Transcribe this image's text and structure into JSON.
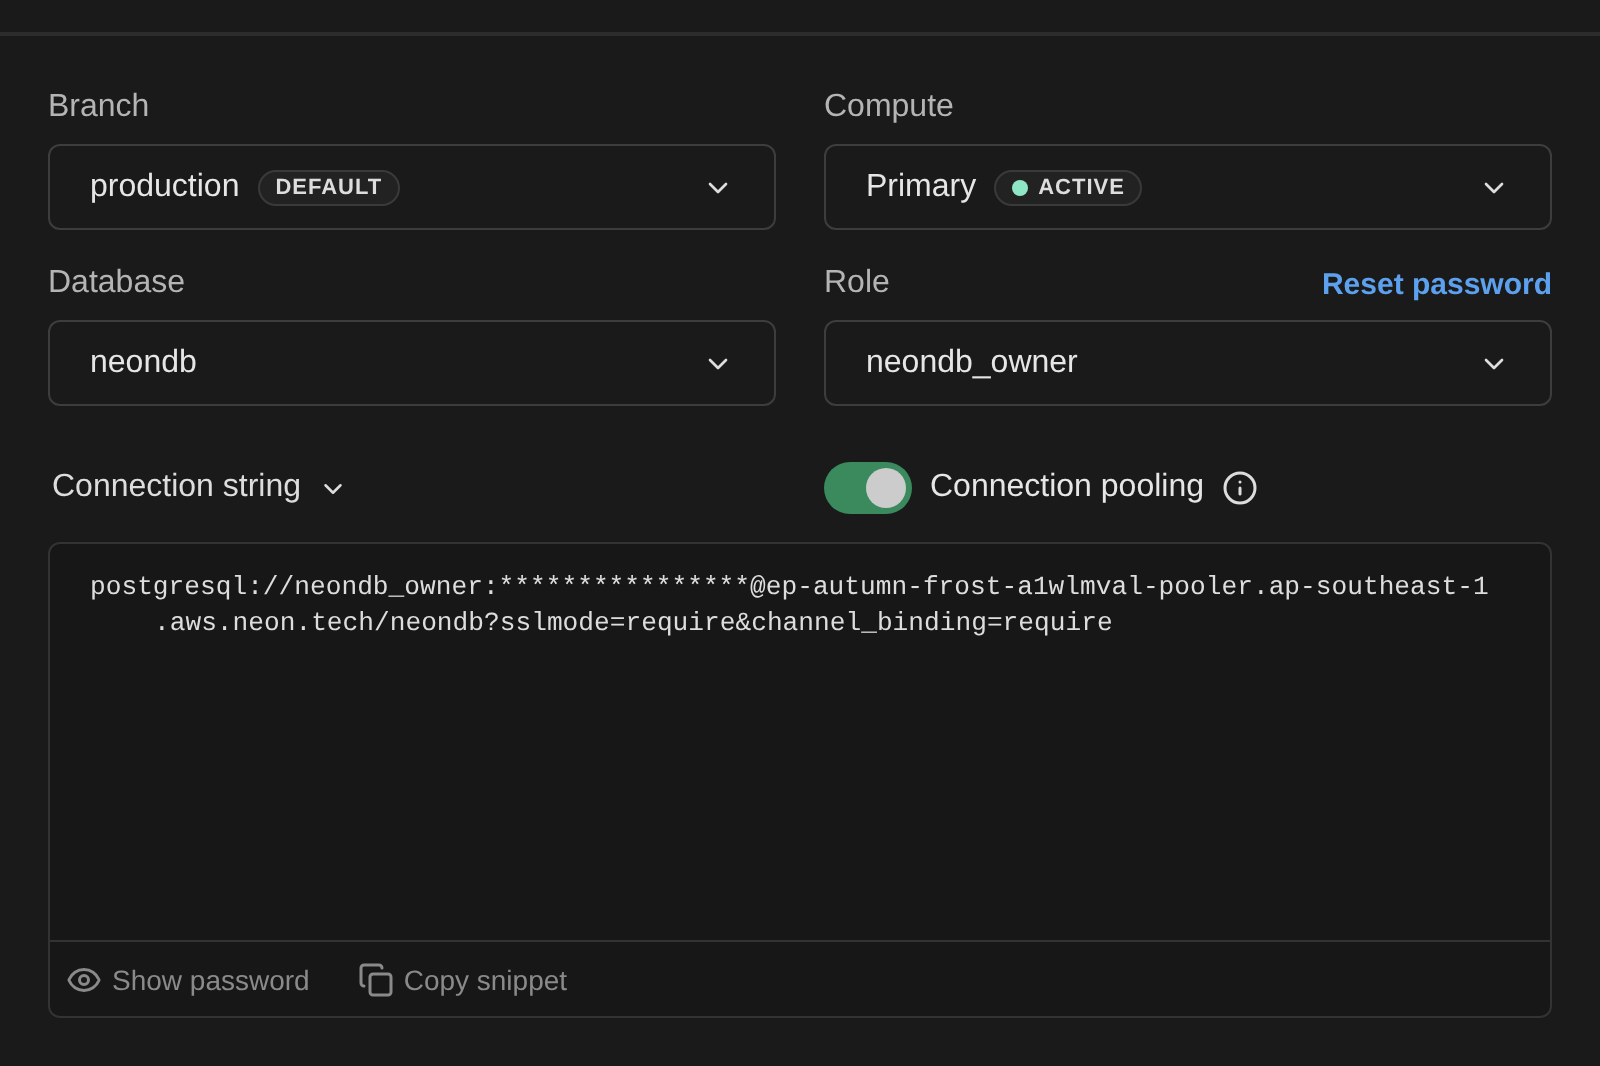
{
  "fields": [
    {
      "label": "Branch",
      "value": "production",
      "badge": {
        "text": "DEFAULT"
      }
    },
    {
      "label": "Compute",
      "value": "Primary",
      "badge": {
        "text": "ACTIVE",
        "color": "#8fe6c4"
      }
    },
    {
      "label": "Database",
      "value": "neondb"
    },
    {
      "label": "Role",
      "value": "neondb_owner",
      "link": "Reset password"
    }
  ],
  "connection": {
    "format": "Connection string",
    "pooling": {
      "label": "Connection pooling",
      "on": true
    }
  },
  "snippet": {
    "lines": [
      "postgresql://neondb_owner:****************@ep-autumn-frost-a1wlmval-pooler.ap-southeast-1",
      ".aws.neon.tech/neondb?sslmode=require&channel_binding=require"
    ]
  },
  "actions": [
    "Show password",
    "Copy snippet"
  ]
}
